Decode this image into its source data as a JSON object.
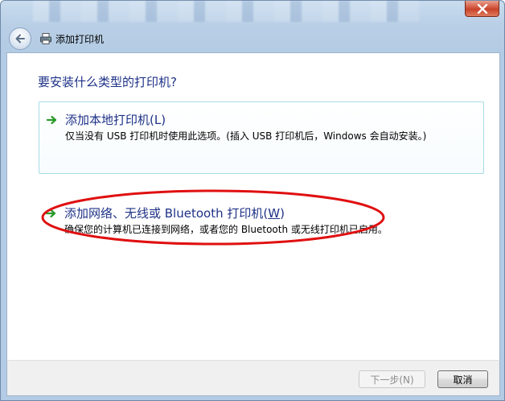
{
  "window": {
    "title": "添加打印机",
    "close_icon": "close-icon"
  },
  "nav": {
    "back_icon": "back-arrow-icon",
    "printer_icon": "printer-icon",
    "title": "添加打印机"
  },
  "main": {
    "question": "要安装什么类型的打印机?",
    "options": [
      {
        "title": "添加本地打印机(L)",
        "description": "仅当没有 USB 打印机时使用此选项。(插入 USB 打印机后，Windows 会自动安装。)",
        "icon": "green-arrow-icon"
      },
      {
        "title_prefix": "添加网络、无线或 Bluetooth 打印机(",
        "title_key": "W",
        "title_suffix": ")",
        "description": "确保您的计算机已连接到网络，或者您的 Bluetooth 或无线打印机已启用。",
        "icon": "green-arrow-icon",
        "highlighted": true
      }
    ],
    "highlight_color": "#e01010"
  },
  "footer": {
    "next_label": "下一步(N)",
    "next_enabled": false,
    "cancel_label": "取消"
  },
  "colors": {
    "heading": "#1e3287",
    "close_button": "#c7432a",
    "arrow": "#2a9a2a"
  }
}
